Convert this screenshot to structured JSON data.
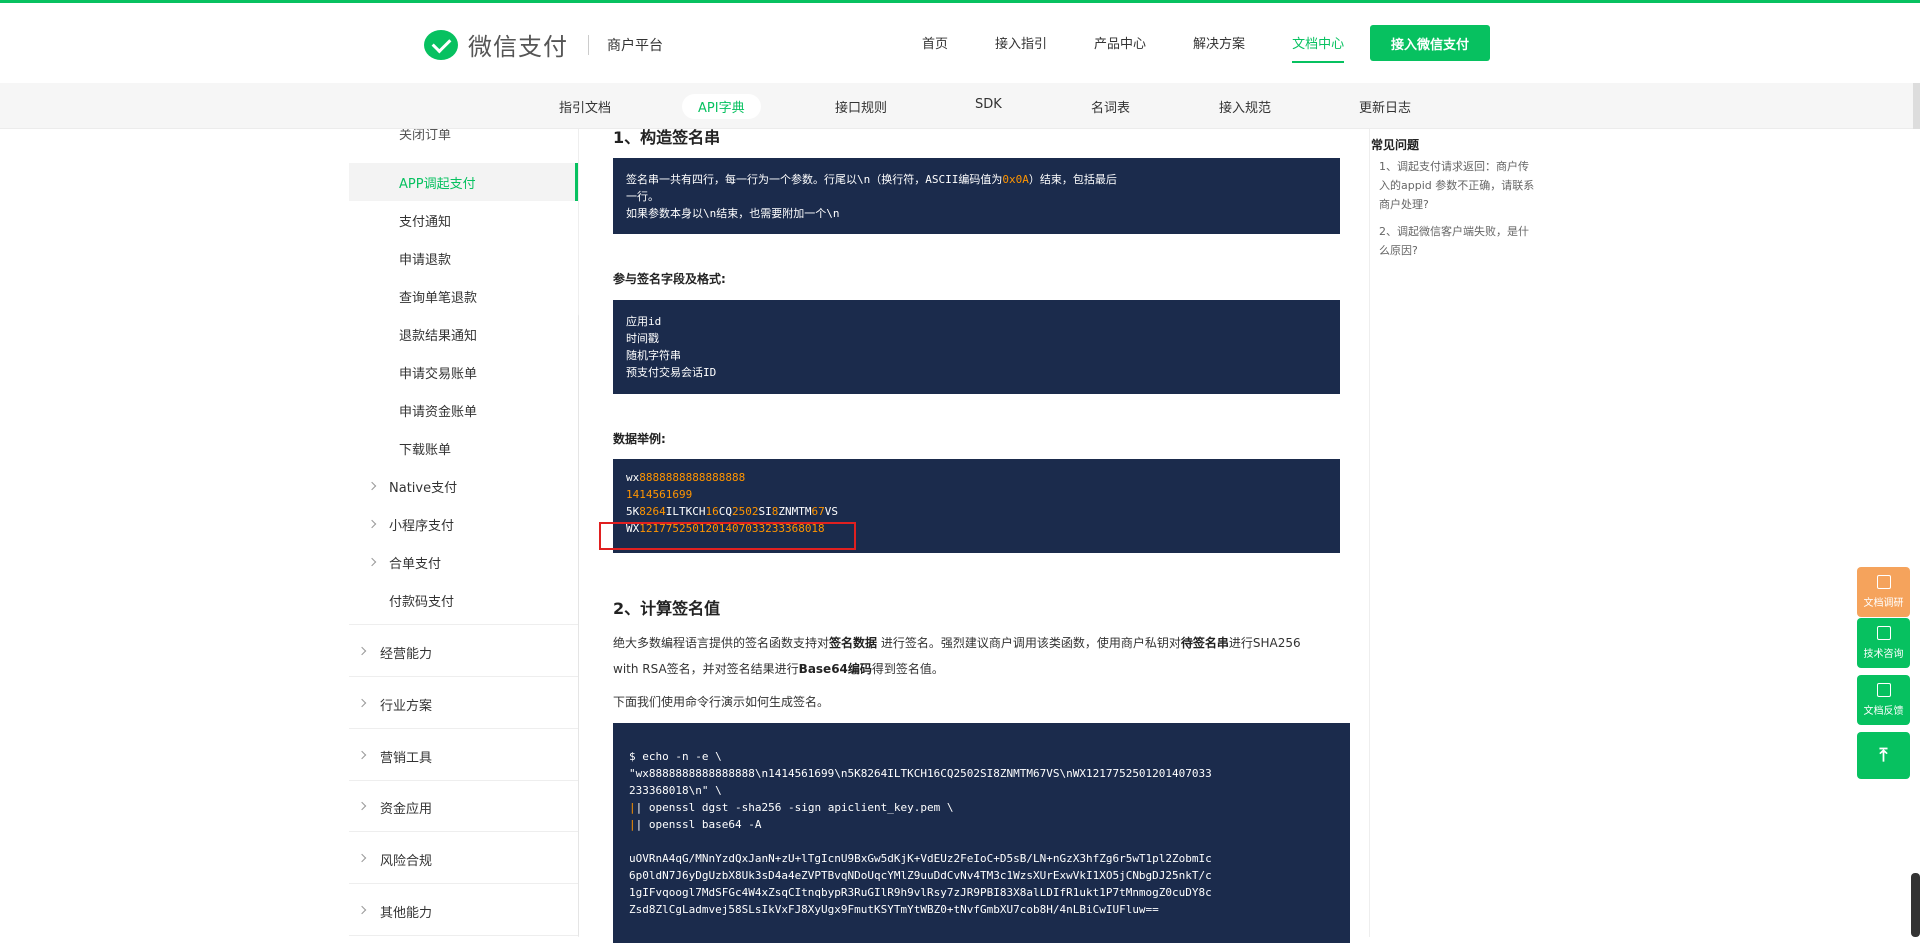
{
  "header": {
    "brand": "微信支付",
    "sub": "商户平台",
    "nav": [
      "首页",
      "接入指引",
      "产品中心",
      "解决方案",
      "文档中心"
    ],
    "cta": "接入微信支付"
  },
  "subnav": [
    "指引文档",
    "API字典",
    "接口规则",
    "SDK",
    "名词表",
    "接入规范",
    "更新日志"
  ],
  "sidebar": {
    "items": [
      "关闭订单",
      "APP调起支付",
      "支付通知",
      "申请退款",
      "查询单笔退款",
      "退款结果通知",
      "申请交易账单",
      "申请资金账单",
      "下载账单"
    ],
    "groups": [
      "Native支付",
      "小程序支付",
      "合单支付",
      "付款码支付"
    ],
    "sections": [
      "经营能力",
      "行业方案",
      "营销工具",
      "资金应用",
      "风险合规",
      "其他能力"
    ]
  },
  "content": {
    "h1": "1、构造签名串",
    "box1": {
      "l1a": "签名串一共有四行，每一行为一个参数。行尾以\\n（换行符，ASCII编码值为",
      "l1b": "0x0A",
      "l1c": "）结束，包括最后",
      "l2": "一行。",
      "l3": "如果参数本身以\\n结束，也需要附加一个\\n"
    },
    "label1": "参与签名字段及格式:",
    "box2": [
      "应用id",
      "时间戳",
      "随机字符串",
      "预支付交易会话ID"
    ],
    "label2": "数据举例:",
    "box3": {
      "r1a": "wx",
      "r1b": "8888888888888888",
      "r2": "1414561699",
      "r3": [
        "5K",
        "8264",
        "ILTKCH",
        "16",
        "CQ",
        "2502",
        "SI",
        "8",
        "ZNMTM",
        "67",
        "VS"
      ],
      "r4a": "WX",
      "r4b": "1217752501201407033233368018"
    },
    "h2": "2、计算签名值",
    "p1": {
      "a": "绝大多数编程语言提供的签名函数支持对",
      "b": "签名数据",
      "c": " 进行签名。强烈建议商户调用该类函数，使用商户私钥对",
      "d": "待签名串",
      "e": "进行SHA256",
      "f": "with RSA签名，并对签名结果进行",
      "g": "Base64编码",
      "h": "得到签名值。"
    },
    "p2": "下面我们使用命令行演示如何生成签名。",
    "cmd": [
      "$ echo -n -e \\",
      "\"wx8888888888888888\\n1414561699\\n5K8264ILTKCH16CQ2502SI8ZNMTM67VS\\nWX1217752501201407033",
      "233368018\\n\" \\",
      "  | openssl dgst -sha256 -sign apiclient_key.pem \\",
      "  | openssl base64 -A",
      "",
      "uOVRnA4qG/MNnYzdQxJanN+zU+lTgIcnU9BxGw5dKjK+VdEUz2FeIoC+D5sB/LN+nGzX3hfZg6r5wT1pl2ZobmIc",
      "6p0ldN7J6yDgUzbX8Uk3sD4a4eZVPTBvqNDoUqcYMlZ9uuDdCvNv4TM3c1WzsXUrExwVkI1XO5jCNbgDJ25nkT/c",
      "1gIFvqoogl7MdSFGc4W4xZsqCItnqbypR3RuGIlR9h9vlRsy7zJR9PBI83X8alLDIfR1ukt1P7tMnmogZ0cuDY8c",
      "Zsd8ZlCgLadmvej58SLsIkVxFJ8XyUgx9FmutKSYTmYtWBZ0+tNvfGmbXU7cob8H/4nLBiCwIUFluw=="
    ]
  },
  "faq": {
    "title": "常见问题",
    "q1": "1、调起支付请求返回：商户传入的appid 参数不正确，请联系商户处理?",
    "q2": "2、调起微信客户端失败，是什么原因?"
  },
  "float": [
    "文档调研",
    "技术咨询",
    "文档反馈"
  ],
  "colors": {
    "accent": "#07c160",
    "code_bg": "#1b2b4c",
    "highlight": "#ff9500"
  }
}
